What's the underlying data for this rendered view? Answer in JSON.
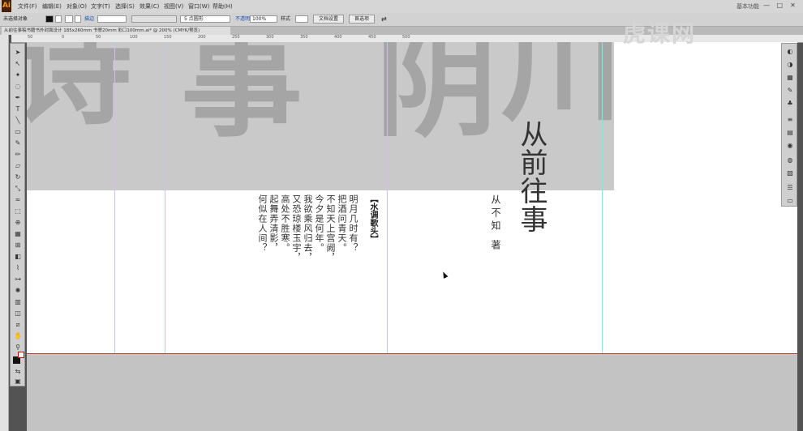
{
  "app": {
    "logo": "Ai",
    "menu": [
      "文件(F)",
      "编辑(E)",
      "对象(O)",
      "文字(T)",
      "选择(S)",
      "效果(C)",
      "视图(V)",
      "窗口(W)",
      "帮助(H)"
    ],
    "workspace": "基本功能",
    "window_buttons": [
      "—",
      "□",
      "✕"
    ]
  },
  "control_bar": {
    "selection_label": "未选择对象",
    "stroke_label": "描边",
    "stroke_size_value": "5",
    "stroke_style_value": "点圆形",
    "opacity_label": "不透明度",
    "opacity_value": "100%",
    "style_label": "样式",
    "doc_setup_button": "文档设置",
    "preferences_button": "首选项"
  },
  "document_tab": {
    "title": "从前往事稿书籍书外封面设计 185x260mm 书脊20mm 彩口100mm.ai* @ 200% (CMYK/预览)"
  },
  "ruler_ticks": [
    "50",
    "0",
    "50",
    "100",
    "150",
    "200",
    "250",
    "300",
    "350",
    "400",
    "450",
    "500"
  ],
  "watermark": "虎课网",
  "cover": {
    "background_chars": [
      "诗",
      "事",
      "阴",
      "川"
    ],
    "title": "从前往事",
    "author": "从不知 著",
    "poem_heading": "【水调歌头】",
    "poem_lines": [
      "明月几时有？",
      "把酒问青天。",
      "不知天上宫阙，",
      "今夕是何年。",
      "我欲乘风归去，",
      "又恐琼楼玉宇，",
      "高处不胜寒。",
      "起舞弄清影，",
      "何似在人间？"
    ]
  },
  "colors": {
    "app_bg": "#535353",
    "panel": "#d6d6d6",
    "guide": "#9fd9e6",
    "bleed_line": "#c04040"
  }
}
